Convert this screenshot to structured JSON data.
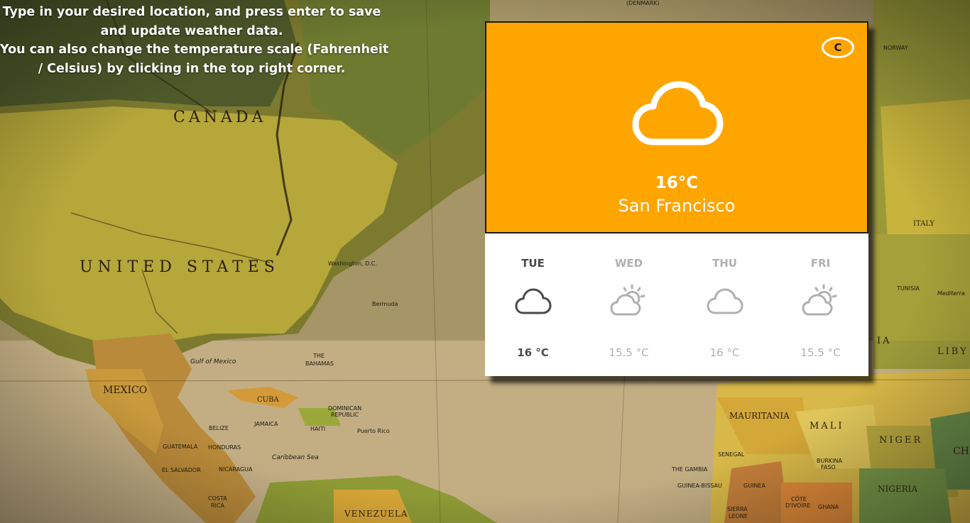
{
  "instructions": {
    "line1": "Type in your desired location, and press enter to save",
    "line2": "and update weather data.",
    "line3": "You can also change the temperature scale (Fahrenheit",
    "line4": "/ Celsius) by clicking in the top right corner."
  },
  "current": {
    "scale_toggle": "C",
    "icon": "cloud-icon",
    "temperature": "16°C",
    "location": "San Francisco",
    "accent_color": "#ffa500"
  },
  "forecast": [
    {
      "day": "TUE",
      "icon": "cloud-icon",
      "temp": "16 °C"
    },
    {
      "day": "WED",
      "icon": "partly-sunny-icon",
      "temp": "15.5 °C"
    },
    {
      "day": "THU",
      "icon": "cloud-icon",
      "temp": "16 °C"
    },
    {
      "day": "FRI",
      "icon": "partly-sunny-icon",
      "temp": "15.5 °C"
    }
  ],
  "map_labels": {
    "canada": "CANADA",
    "united_states": "UNITED STATES",
    "mexico": "MEXICO",
    "cuba": "CUBA",
    "venezuela": "VENEZUELA",
    "mauritania": "MAURITANIA",
    "mali": "MALI",
    "niger": "NIGER",
    "nigeria": "NIGERIA",
    "italy": "ITALY",
    "gulf_of_mexico": "Gulf of Mexico",
    "caribbean_sea": "Caribbean Sea",
    "bahamas_1": "THE",
    "bahamas_2": "BAHAMAS",
    "bermuda": "Bermuda",
    "washington": "Washington, D.C.",
    "denmark": "(DENMARK)",
    "norway": "NORWAY",
    "tunisia": "TUNISIA",
    "guatemala": "GUATEMALA",
    "honduras": "HONDURAS",
    "nicaragua": "NICARAGUA",
    "el_salvador": "EL SALVADOR",
    "costa_rica_1": "COSTA",
    "costa_rica_2": "RICA",
    "belize": "BELIZE",
    "haiti": "HAITI",
    "jamaica": "JAMAICA",
    "dominican_1": "DOMINICAN",
    "dominican_2": "REPUBLIC",
    "puerto_rico": "Puerto Rico",
    "senegal": "SENEGAL",
    "the_gambia": "THE GAMBIA",
    "guinea": "GUINEA",
    "guinea_bissau": "GUINEA-BISSAU",
    "libya": "LIBY",
    "sierra_leone_1": "SIERRA",
    "sierra_leone_2": "LEONE",
    "ghana": "GHANA",
    "burkina_1": "BURKINA",
    "burkina_2": "FASO",
    "cote_1": "CÔTE",
    "cote_2": "D'IVOIRE",
    "chad": "CH",
    "ia": "IA",
    "mediterranean": "Mediterra"
  }
}
